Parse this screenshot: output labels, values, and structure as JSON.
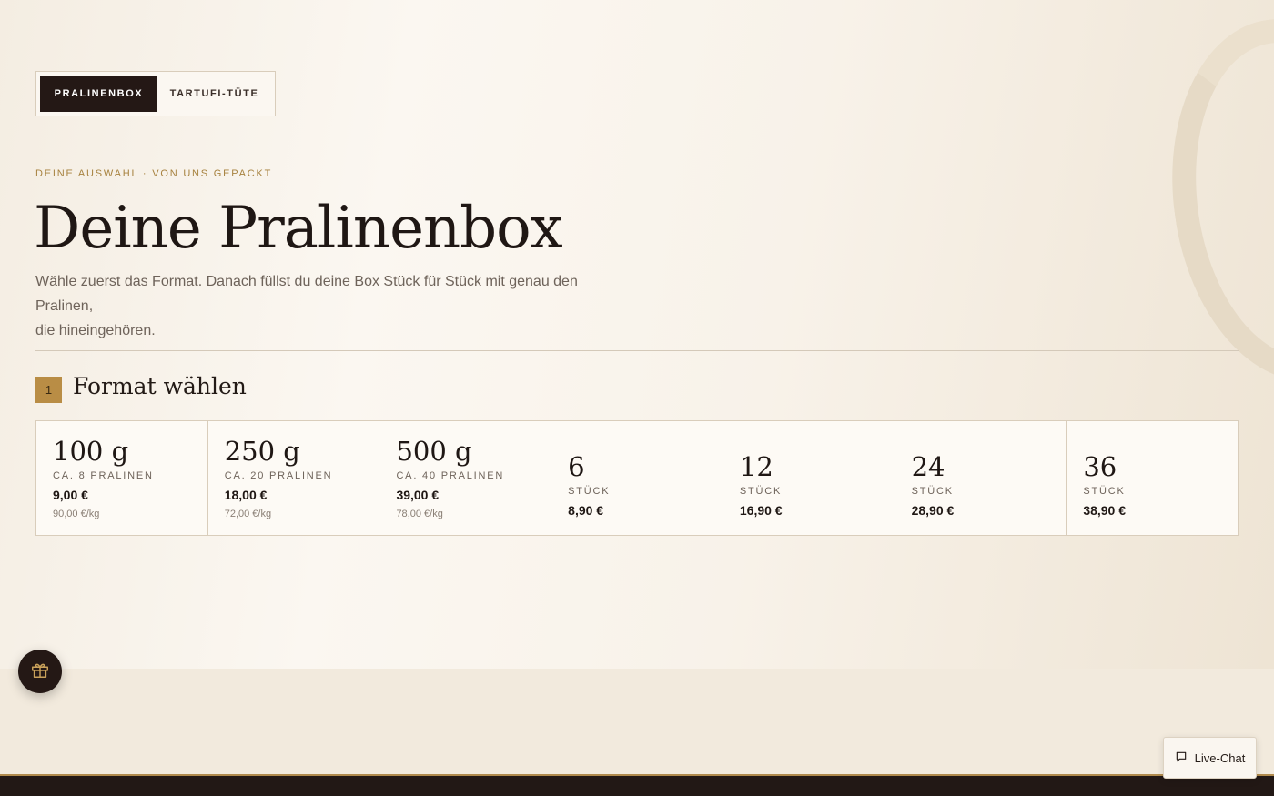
{
  "tabs": [
    {
      "label": "PRALINENBOX",
      "active": true
    },
    {
      "label": "TARTUFI-TÜTE",
      "active": false
    }
  ],
  "hero": {
    "eyebrow": "DEINE AUSWAHL · VON UNS GEPACKT",
    "title": "Deine Pralinenbox",
    "intro_line1": "Wähle zuerst das Format. Danach füllst du deine Box Stück für Stück mit genau den Pralinen,",
    "intro_line2": "die hineingehören."
  },
  "step": {
    "number": "1",
    "title": "Format wählen"
  },
  "formats": [
    {
      "name": "100 g",
      "sub": "CA. 8 PRALINEN",
      "price": "9,00 €",
      "unit_price": "90,00 €/kg"
    },
    {
      "name": "250 g",
      "sub": "CA. 20 PRALINEN",
      "price": "18,00 €",
      "unit_price": "72,00 €/kg"
    },
    {
      "name": "500 g",
      "sub": "CA. 40 PRALINEN",
      "price": "39,00 €",
      "unit_price": "78,00 €/kg"
    },
    {
      "name": "6",
      "sub": "STÜCK",
      "price": "8,90 €"
    },
    {
      "name": "12",
      "sub": "STÜCK",
      "price": "16,90 €"
    },
    {
      "name": "24",
      "sub": "STÜCK",
      "price": "28,90 €"
    },
    {
      "name": "36",
      "sub": "STÜCK",
      "price": "38,90 €"
    }
  ],
  "floating": {
    "gift_icon": "gift-icon",
    "chat_icon": "chat-bubble-icon",
    "chat_label": "Live-Chat"
  },
  "colors": {
    "accent_gold": "#b98d45",
    "dark_brown": "#241815",
    "background_cream": "#f8f2e9"
  }
}
